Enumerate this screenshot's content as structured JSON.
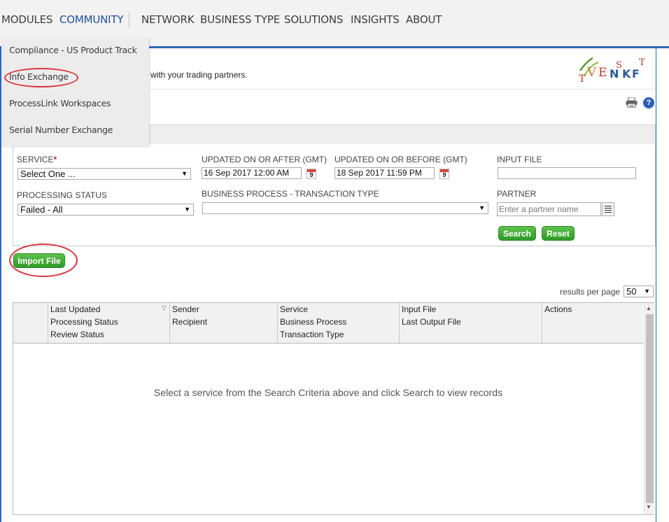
{
  "nav": {
    "items": [
      "MODULES",
      "COMMUNITY",
      "NETWORK",
      "BUSINESS TYPE",
      "SOLUTIONS",
      "INSIGHTS",
      "ABOUT"
    ],
    "active": "COMMUNITY"
  },
  "dropdown": {
    "items": [
      "Compliance - US Product Track",
      "Info Exchange",
      "ProcessLink Workspaces",
      "Serial Number Exchange"
    ]
  },
  "header": {
    "text": "with your trading partners.",
    "logo_alt": "TENSKT"
  },
  "help_label": "?",
  "form": {
    "service_label": "SERVICE",
    "service_required": "*",
    "service_value": "Select One ...",
    "updated_after_label": "UPDATED ON OR AFTER (GMT)",
    "updated_after_value": "16 Sep 2017 12:00 AM",
    "updated_before_label": "UPDATED ON OR BEFORE (GMT)",
    "updated_before_value": "18 Sep 2017 11:59 PM",
    "calendar_day": "9",
    "input_file_label": "INPUT FILE",
    "input_file_value": "",
    "processing_status_label": "PROCESSING STATUS",
    "processing_status_value": "Failed - All",
    "business_process_label": "BUSINESS PROCESS - TRANSACTION TYPE",
    "business_process_value": "",
    "partner_label": "PARTNER",
    "partner_placeholder": "Enter a partner name",
    "search_button": "Search",
    "reset_button": "Reset"
  },
  "import_button": "Import File",
  "results": {
    "per_page_label": "results per page",
    "per_page_value": "50"
  },
  "table": {
    "columns": [
      [
        "Last Updated",
        "Processing Status",
        "Review Status"
      ],
      [
        "Sender",
        "Recipient"
      ],
      [
        "Service",
        "Business Process",
        "Transaction Type"
      ],
      [
        "Input File",
        "Last Output File"
      ],
      [
        "Actions"
      ]
    ],
    "empty_message": "Select a service from the Search Criteria above and click Search to view records"
  },
  "colors": {
    "accent_blue": "#2f66b3",
    "active_nav": "#1d4f9f",
    "button_green": "#3aa833",
    "annotation_red": "#d9363e"
  }
}
